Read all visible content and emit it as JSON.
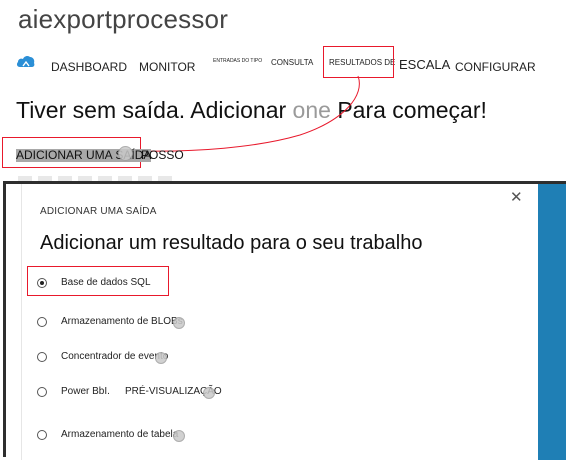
{
  "app": {
    "title": "aiexportprocessor"
  },
  "nav": {
    "cloud_icon": "cloud-icon",
    "items": [
      {
        "label": "DASHBOARD"
      },
      {
        "label": "MONITOR"
      },
      {
        "label": "ENTRADAS DO TIPO"
      },
      {
        "label": "CONSULTA"
      },
      {
        "label": "RESULTADOS DE"
      },
      {
        "label": "ESCALA"
      },
      {
        "label": "CONFIGURAR"
      }
    ],
    "highlight_color": "#e8192c"
  },
  "empty_state": {
    "message_part1": "Tiver sem saída. Adicionar",
    "message_part2": "one",
    "message_part3": "Para começar!"
  },
  "add_output": {
    "label": "ADICIONAR UMA SAÍDA",
    "label_extra": "POSSO"
  },
  "dialog": {
    "eyebrow": "ADICIONAR UMA SAÍDA",
    "heading": "Adicionar um resultado para o seu trabalho",
    "close_icon": "close-icon",
    "sidebar_color": "#1f7fb5",
    "options": [
      {
        "label": "Base de dados SQL",
        "checked": true
      },
      {
        "label": "Armazenamento de BLOBs",
        "checked": false
      },
      {
        "label": "Concentrador de evento",
        "checked": false
      },
      {
        "label": "Power BbI.",
        "preview": "PRÉ-VISUALIZAÇÃO",
        "checked": false
      },
      {
        "label": "Armazenamento de tabela",
        "checked": false
      }
    ]
  }
}
